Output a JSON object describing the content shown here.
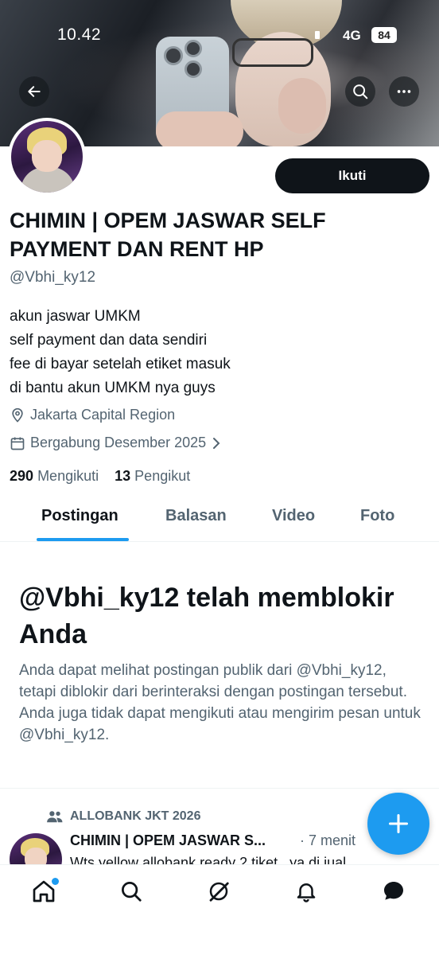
{
  "status_bar": {
    "time": "10.42",
    "network": "4G",
    "battery": "84"
  },
  "header": {
    "back_icon": "arrow-left-icon",
    "search_icon": "search-icon",
    "more_icon": "more-horizontal-icon"
  },
  "profile": {
    "follow_label": "Ikuti",
    "display_name": "CHIMIN | OPEM JASWAR SELF PAYMENT DAN RENT HP",
    "handle": "@Vbhi_ky12",
    "bio": [
      "akun jaswar UMKM",
      "self payment dan data sendiri",
      "fee di bayar setelah etiket masuk",
      "di bantu akun UMKM nya guys"
    ],
    "location": "Jakarta Capital Region",
    "joined": "Bergabung Desember 2025",
    "following_count": "290",
    "following_label": "Mengikuti",
    "followers_count": "13",
    "followers_label": "Pengikut"
  },
  "tabs": [
    {
      "label": "Postingan",
      "active": true
    },
    {
      "label": "Balasan",
      "active": false
    },
    {
      "label": "Video",
      "active": false
    },
    {
      "label": "Foto",
      "active": false
    }
  ],
  "blocked": {
    "title": "@Vbhi_ky12 telah memblokir Anda",
    "message": "Anda dapat melihat postingan publik dari @Vbhi_ky12, tetapi diblokir dari berinteraksi dengan postingan tersebut. Anda juga tidak dapat mengikuti atau mengirim pesan untuk @Vbhi_ky12."
  },
  "post": {
    "community": "ALLOBANK JKT 2026",
    "author": "CHIMIN | OPEM JASWAR S...",
    "time": "· 7 menit",
    "text": "Wts yellow allobank ready 2 tiket , ya di jual"
  },
  "colors": {
    "accent": "#1d9bf0",
    "text": "#0f1419",
    "secondary": "#536471"
  },
  "bottom_nav": [
    "home-icon",
    "search-icon",
    "grok-icon",
    "notifications-icon",
    "messages-icon"
  ]
}
